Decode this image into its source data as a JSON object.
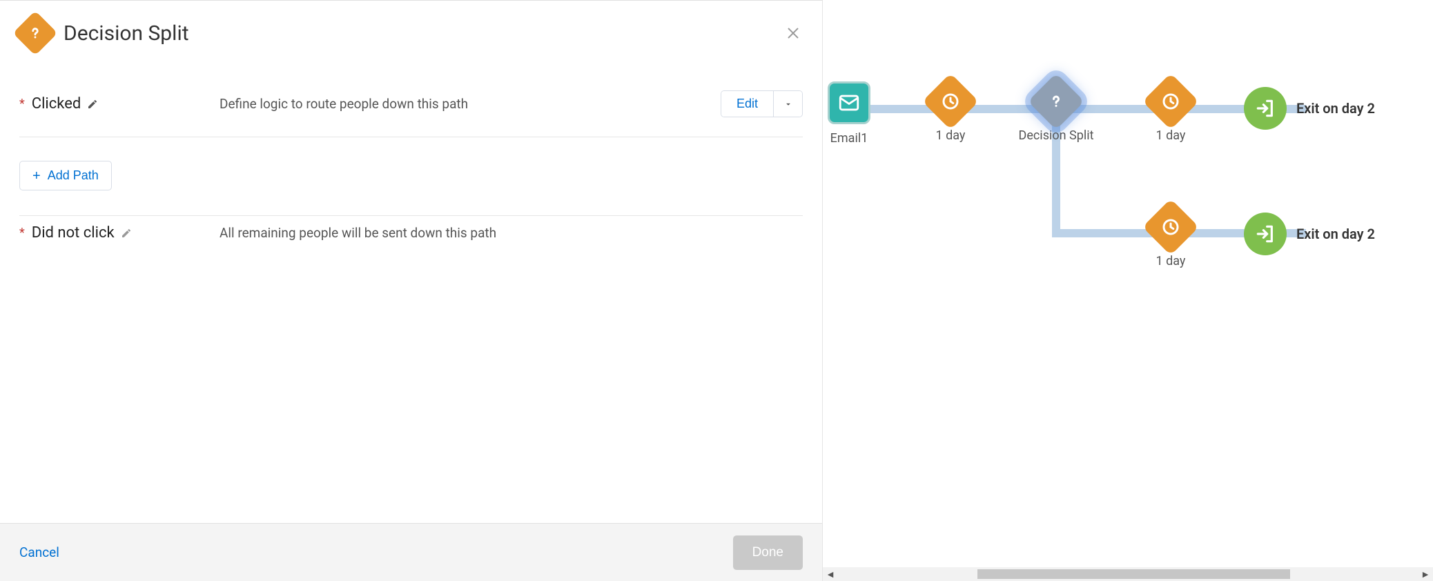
{
  "panel": {
    "title": "Decision Split",
    "paths": [
      {
        "name": "Clicked",
        "required": true,
        "desc": "Define logic to route people down this path",
        "editable": true,
        "edit_label": "Edit"
      },
      {
        "name": "Did not click",
        "required": true,
        "desc": "All remaining people will be sent down this path",
        "editable": false
      }
    ],
    "add_path_label": "Add Path",
    "footer": {
      "cancel": "Cancel",
      "done": "Done"
    }
  },
  "canvas": {
    "nodes": {
      "email": {
        "label": "Email1"
      },
      "wait1": {
        "label": "1 day"
      },
      "decision": {
        "label": "Decision Split"
      },
      "wait2": {
        "label": "1 day"
      },
      "wait3": {
        "label": "1 day"
      },
      "exit1": {
        "label": "Exit on day 2"
      },
      "exit2": {
        "label": "Exit on day 2"
      }
    }
  }
}
